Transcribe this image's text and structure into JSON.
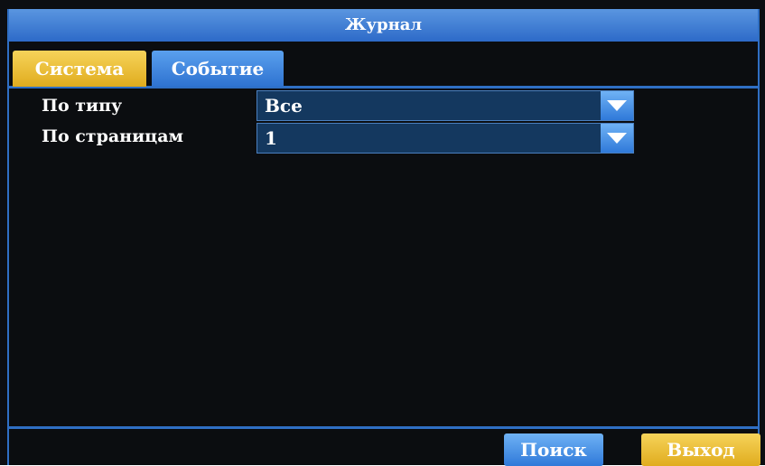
{
  "window": {
    "title": "Журнал"
  },
  "tabs": [
    {
      "label": "Система"
    },
    {
      "label": "Событие"
    }
  ],
  "filters": {
    "type": {
      "label": "По типу",
      "value": "Все"
    },
    "pages": {
      "label": "По страницам",
      "value": "1"
    }
  },
  "buttons": {
    "search": "Поиск",
    "exit": "Выход"
  },
  "colors": {
    "accent_blue": "#2f6fc4",
    "accent_yellow": "#e0ac1e",
    "background": "#0b0d10"
  },
  "icons": {
    "dropdown": "chevron-down-icon"
  }
}
